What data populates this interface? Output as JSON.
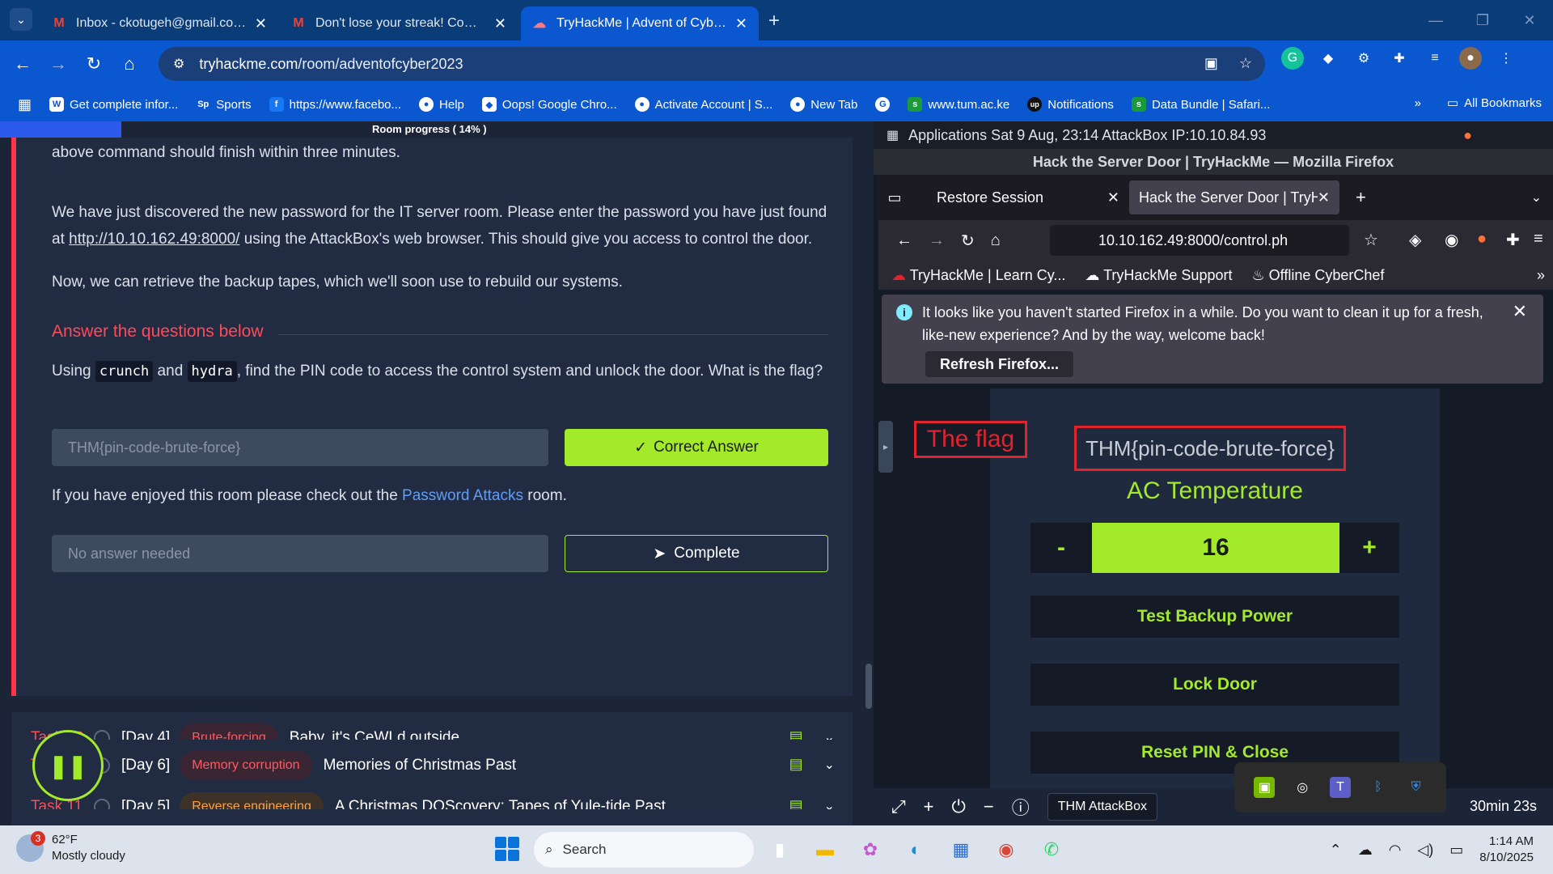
{
  "browser": {
    "tabs": [
      {
        "title": "Inbox - ckotugeh@gmail.com -",
        "favicon": "gmail-icon"
      },
      {
        "title": "Don't lose your streak! Come b",
        "favicon": "gmail-icon"
      },
      {
        "title": "TryHackMe | Advent of Cyber 20",
        "favicon": "tryhackme-icon"
      }
    ],
    "url_domain": "tryhackme.com",
    "url_path": "/room/adventofcyber2023",
    "bookmarks": [
      {
        "label": "Get complete infor...",
        "icon": "W"
      },
      {
        "label": "Sports",
        "icon": "Sp"
      },
      {
        "label": "https://www.facebo...",
        "icon": "f"
      },
      {
        "label": "Help",
        "icon": "●"
      },
      {
        "label": "Oops! Google Chro...",
        "icon": "◆"
      },
      {
        "label": "Activate Account | S...",
        "icon": "●"
      },
      {
        "label": "New Tab",
        "icon": "●"
      },
      {
        "label": "",
        "icon": "G"
      },
      {
        "label": "www.tum.ac.ke",
        "icon": "s"
      },
      {
        "label": "Notifications",
        "icon": "up"
      },
      {
        "label": "Data Bundle | Safari...",
        "icon": "s"
      }
    ],
    "all_bookmarks": "All Bookmarks"
  },
  "room": {
    "progress_label": "Room progress ( 14% )",
    "progress_fraction": 0.14,
    "para1": "above command should finish within three minutes.",
    "para2_a": "We have just discovered the new password for the IT server room. Please enter the password you have just found at ",
    "para2_link": "http://10.10.162.49:8000/",
    "para2_b": " using the AttackBox's web browser. This should give you access to control the door.",
    "para3": "Now, we can retrieve the backup tapes, which we'll soon use to rebuild our systems.",
    "answer_heading": "Answer the questions below",
    "q1_a": "Using ",
    "q1_code1": "crunch",
    "q1_b": " and ",
    "q1_code2": "hydra",
    "q1_c": ", find the PIN code to access the control system and unlock the door. What is the flag?",
    "q1_answer": "THM{pin-code-brute-force}",
    "correct_label": "Correct Answer",
    "q2_a": "If you have enjoyed this room please check out the ",
    "q2_link": "Password Attacks",
    "q2_b": " room.",
    "q2_placeholder": "No answer needed",
    "complete_label": "Complete"
  },
  "tasks": [
    {
      "num": "Task 10",
      "day": "[Day 4]",
      "tag": "Brute-forcing",
      "title": "Baby, it's CeWLd outside"
    },
    {
      "num": "Task 11",
      "day": "[Day 5]",
      "tag": "Reverse engineering",
      "title": "A Christmas DOScovery: Tapes of Yule-tide Past"
    },
    {
      "num": "Ta",
      "day": "[Day 6]",
      "tag": "Memory corruption",
      "title": "Memories of Christmas Past"
    }
  ],
  "attackbox": {
    "topbar": "Applications  Sat  9 Aug, 23:14  AttackBox IP:10.10.84.93",
    "window_title": "Hack the Server Door | TryHackMe — Mozilla Firefox",
    "tab1": "Restore Session",
    "tab2": "Hack the Server Door | TryHa",
    "url": "10.10.162.49:8000/control.ph",
    "bookmarks": [
      "TryHackMe | Learn Cy...",
      "TryHackMe Support",
      "Offline CyberChef"
    ],
    "notice": "It looks like you haven't started Firefox in a while. Do you want to clean it up for a fresh, like-new experience? And by the way, welcome back!",
    "refresh_label": "Refresh Firefox...",
    "flag_label": "The flag",
    "flag_value": "THM{pin-code-brute-force}",
    "ac_title": "AC Temperature",
    "temp_minus": "-",
    "temp_value": "16",
    "temp_plus": "+",
    "btn_backup": "Test Backup Power",
    "btn_lock": "Lock Door",
    "btn_reset": "Reset PIN & Close",
    "bottom_label": "THM AttackBox",
    "timer": "30min 23s"
  },
  "taskbar": {
    "weather_badge": "3",
    "temp": "62°F",
    "condition": "Mostly cloudy",
    "search": "Search",
    "time": "1:14 AM",
    "date": "8/10/2025"
  },
  "colors": {
    "accent_green": "#a3ea2a",
    "accent_red": "#ff4a57",
    "chrome_blue": "#0b57d0"
  }
}
